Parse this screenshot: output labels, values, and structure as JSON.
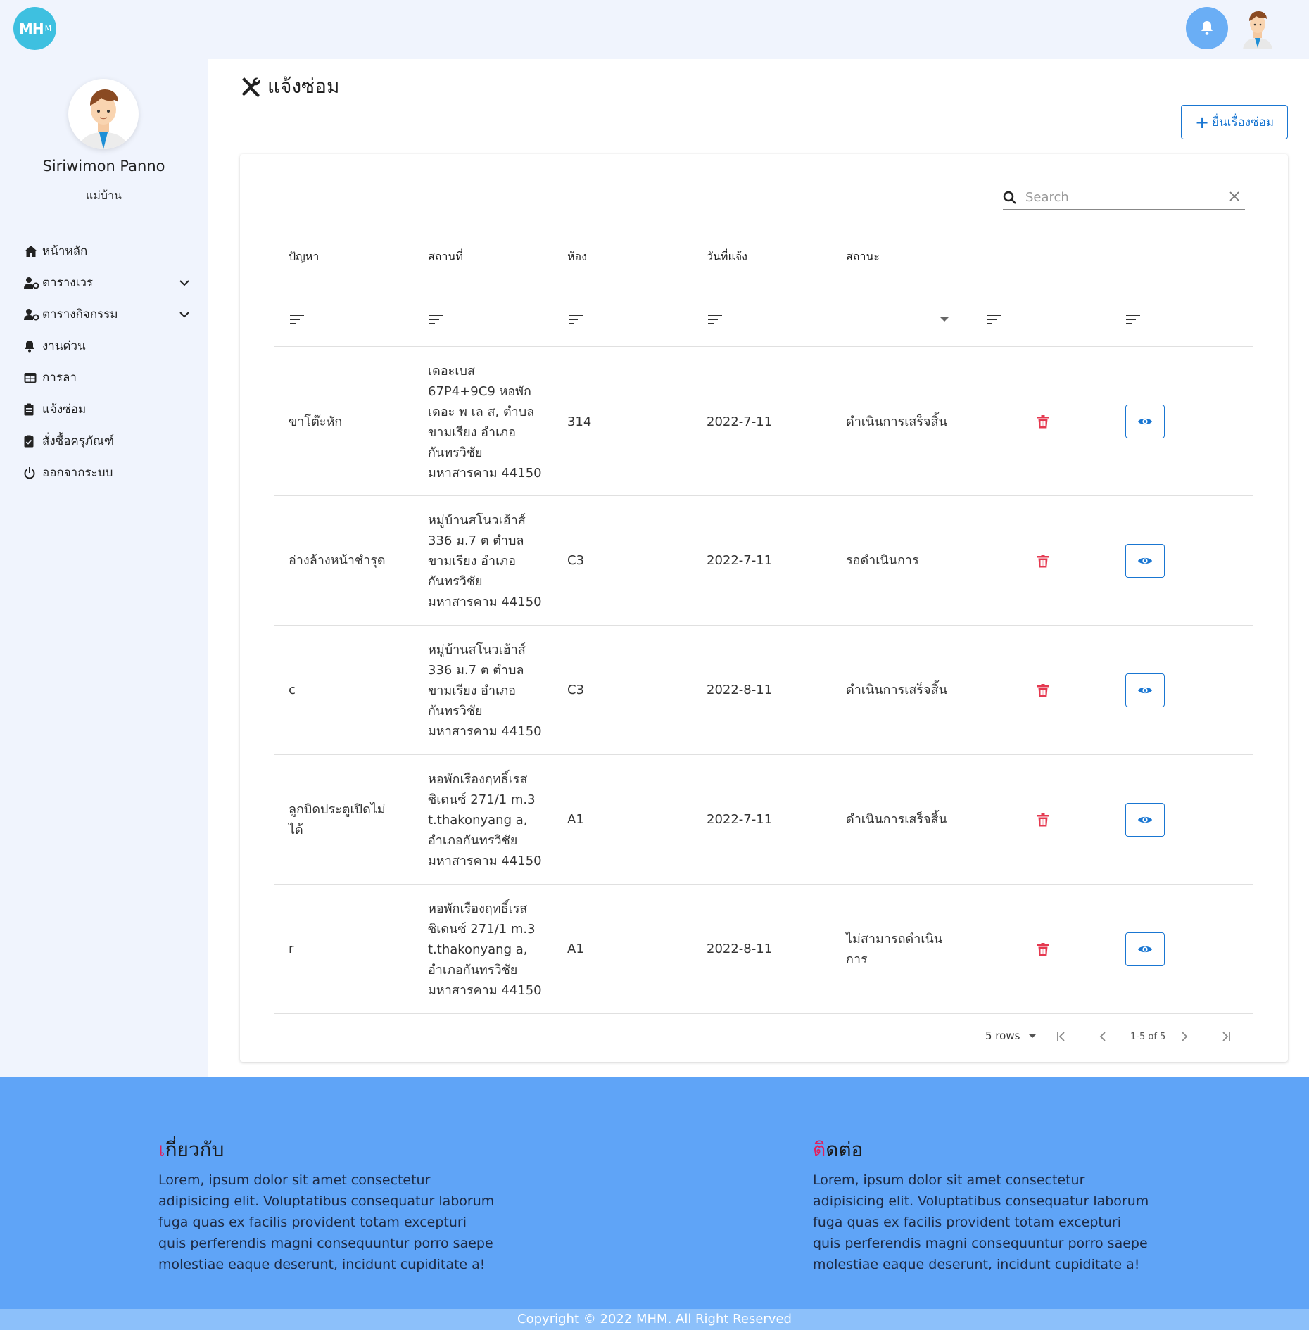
{
  "logo": {
    "main": "MH",
    "sub": "M"
  },
  "sidebar": {
    "user_name": "Siriwimon Panno",
    "user_role": "แม่บ้าน",
    "items": [
      {
        "label": "หน้าหลัก",
        "icon": "home-icon"
      },
      {
        "label": "ตารางเวร",
        "icon": "user-gear-icon"
      },
      {
        "label": "ตารางกิจกรรม",
        "icon": "user-gear-icon"
      },
      {
        "label": "งานด่วน",
        "icon": "bell-icon"
      },
      {
        "label": "การลา",
        "icon": "table-icon"
      },
      {
        "label": "แจ้งซ่อม",
        "icon": "clipboard-icon"
      },
      {
        "label": "สั่งซื้อครุภัณฑ์",
        "icon": "clipboard-check-icon"
      },
      {
        "label": "ออกจากระบบ",
        "icon": "power-icon"
      }
    ]
  },
  "page": {
    "title": "แจ้งซ่อม",
    "add_button": "ยื่นเรื่องซ่อม"
  },
  "search": {
    "placeholder": "Search"
  },
  "table": {
    "headers": [
      "ปัญหา",
      "สถานที่",
      "ห้อง",
      "วันที่แจ้ง",
      "สถานะ"
    ],
    "rows": [
      {
        "problem": "ขาโต๊ะหัก",
        "address": [
          "เดอะเบส",
          "67P4+9C9 หอพัก",
          "เดอะ พ เล ส, ตำบล",
          "ขามเรียง อำเภอ",
          "กันทรวิชัย",
          "มหาสารคาม 44150"
        ],
        "room": "314",
        "date": "2022-7-11",
        "status": "ดำเนินการเสร็จสิ้น"
      },
      {
        "problem": "อ่างล้างหน้าชำรุด",
        "address": [
          "หมู่บ้านสโนวเฮ้าส์",
          "336 ม.7 ต ตำบล",
          "ขามเรียง อำเภอ",
          "กันทรวิชัย",
          "มหาสารคาม 44150"
        ],
        "room": "C3",
        "date": "2022-7-11",
        "status": "รอดำเนินการ"
      },
      {
        "problem": "c",
        "address": [
          "หมู่บ้านสโนวเฮ้าส์",
          "336 ม.7 ต ตำบล",
          "ขามเรียง อำเภอ",
          "กันทรวิชัย",
          "มหาสารคาม 44150"
        ],
        "room": "C3",
        "date": "2022-8-11",
        "status": "ดำเนินการเสร็จสิ้น"
      },
      {
        "problem": [
          "ลูกบิดประตูเปิดไม่",
          "ได้"
        ],
        "address": [
          "หอพักเรืองฤทธิ์เรส",
          "ซิเดนซ์ 271/1 m.3",
          "t.thakonyang a,",
          "อำเภอกันทรวิชัย",
          "มหาสารคาม 44150"
        ],
        "room": "A1",
        "date": "2022-7-11",
        "status": "ดำเนินการเสร็จสิ้น"
      },
      {
        "problem": "r",
        "address": [
          "หอพักเรืองฤทธิ์เรส",
          "ซิเดนซ์ 271/1 m.3",
          "t.thakonyang a,",
          "อำเภอกันทรวิชัย",
          "มหาสารคาม 44150"
        ],
        "room": "A1",
        "date": "2022-8-11",
        "status": [
          "ไม่สามารถดำเนิน",
          "การ"
        ]
      }
    ]
  },
  "pagination": {
    "rows_label": "5 rows",
    "range": "1-5 of 5"
  },
  "footer": {
    "about_title_accent": "เ",
    "about_title_rest": "กี่ยวกับ",
    "contact_title_accent": "ติ",
    "contact_title_rest": "ดต่อ",
    "lorem": "Lorem, ipsum dolor sit amet consectetur adipisicing elit. Voluptatibus consequatur laborum fuga quas ex facilis provident totam excepturi quis perferendis magni consequuntur porro saepe molestiae eaque deserunt, incidunt cupiditate a!",
    "copyright": "Copyright © 2022 MHM. All Right Reserved"
  },
  "colors": {
    "primary": "#1976d2",
    "danger": "#e53950",
    "footer_bg": "#5fa4f7",
    "accent": "#e31e5b",
    "sidebar_bg": "#f0f4fd"
  }
}
